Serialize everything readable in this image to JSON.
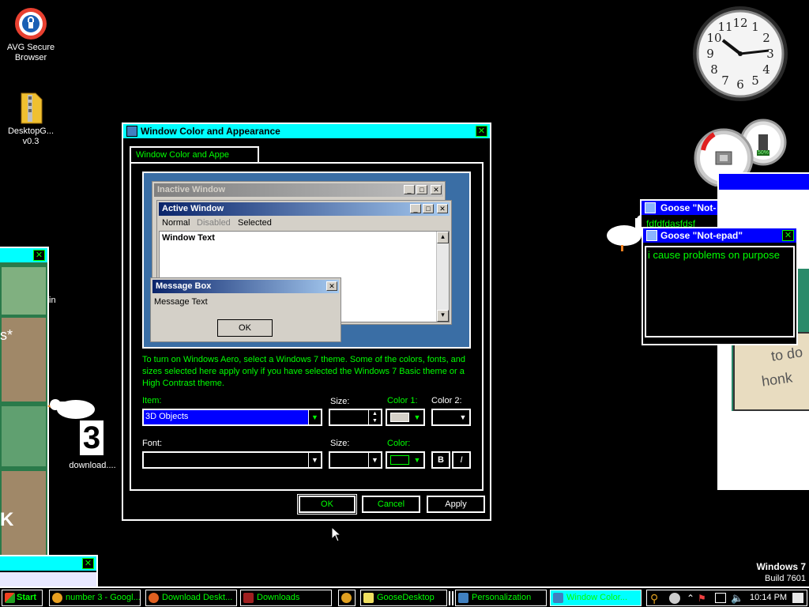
{
  "desktop": {
    "icons": [
      {
        "label": "AVG Secure Browser"
      },
      {
        "label": "DesktopG... v0.3"
      },
      {
        "label": "download...."
      }
    ],
    "partial_text_left": "in",
    "partial_text_left2": "s*",
    "partial_text_left3": "K",
    "download_number": "3",
    "windows_brand": "Windows 7",
    "windows_build": "Build 7601",
    "note_text1": "to do",
    "note_text2": "honk",
    "gauge_percent": "50%"
  },
  "clock": {
    "numbers": [
      "12",
      "1",
      "2",
      "3",
      "4",
      "5",
      "6",
      "7",
      "8",
      "9",
      "10",
      "11"
    ]
  },
  "dialog": {
    "title": "Window Color and Appearance",
    "tab": "Window Color and Appe",
    "preview": {
      "inactive_title": "Inactive Window",
      "active_title": "Active Window",
      "menu": [
        "Normal",
        "Disabled",
        "Selected"
      ],
      "window_text": "Window Text",
      "msgbox_title": "Message Box",
      "msgbox_text": "Message Text",
      "msgbox_ok": "OK"
    },
    "info": "To turn on Windows Aero, select a Windows 7 theme.  Some of the colors, fonts, and sizes selected here apply only if you have selected the Windows 7 Basic theme or a High Contrast theme.",
    "item_label": "Item:",
    "item_value": "3D Objects",
    "size_label": "Size:",
    "color1_label": "Color 1:",
    "color2_label": "Color 2:",
    "font_label": "Font:",
    "size2_label": "Size:",
    "color_label": "Color:",
    "bold_label": "B",
    "italic_label": "I",
    "ok": "OK",
    "cancel": "Cancel",
    "apply": "Apply"
  },
  "goose_window_back": {
    "title": "Goose \"Not-",
    "text": "fdfdfdasfdsf"
  },
  "goose_window": {
    "title": "Goose \"Not-epad\"",
    "text": "i cause problems on purpose"
  },
  "taskbar": {
    "start": "Start",
    "items": [
      {
        "label": "number 3 - Googl...",
        "color": "#e8a020"
      },
      {
        "label": "Download Deskt...",
        "color": "#e06020"
      },
      {
        "label": "Downloads",
        "color": "#a02020"
      },
      {
        "label": "",
        "color": "#e0a020"
      },
      {
        "label": "GooseDesktop",
        "color": "#f0e060"
      },
      {
        "label": "Personalization",
        "color": "#4080c0"
      },
      {
        "label": "Window Color...",
        "color": "#4080c0"
      }
    ],
    "time": "10:14 PM"
  },
  "colors": {
    "hc_title": "#00ffff",
    "hc_text": "#00ff00",
    "selection": "#0000ff"
  }
}
